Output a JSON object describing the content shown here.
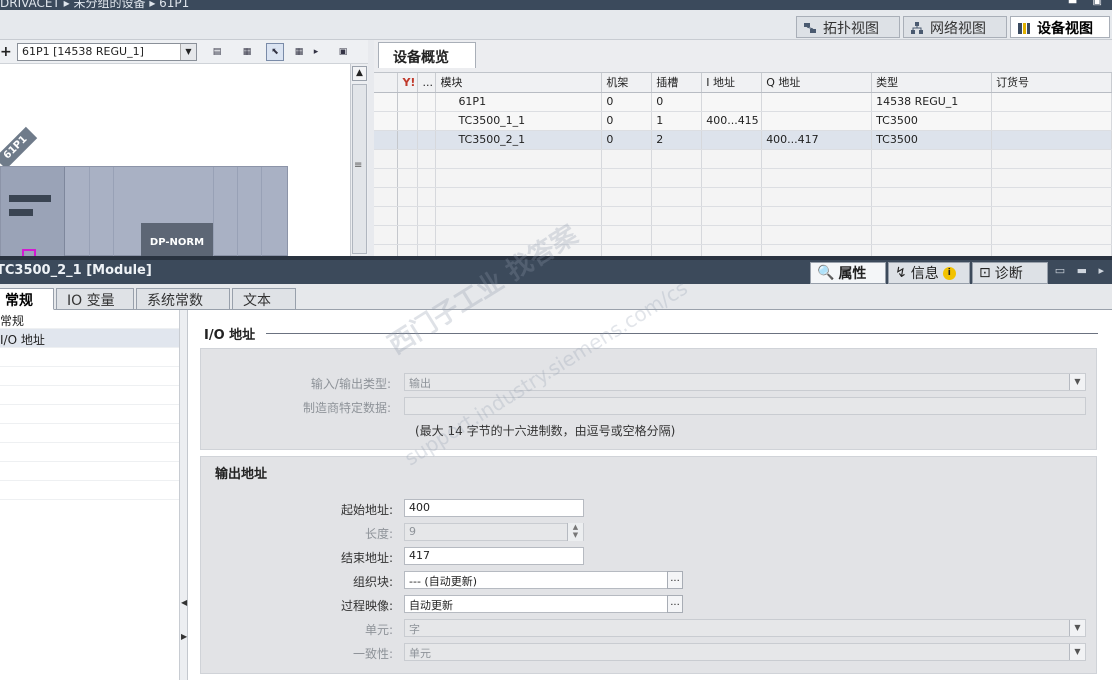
{
  "breadcrumb": {
    "text": "DRIVACET  ▸  未分组的设备  ▸  61P1"
  },
  "window_controls": "▬ ▣",
  "view_tabs": [
    {
      "label": "拓扑视图",
      "icon": "topology-icon"
    },
    {
      "label": "网络视图",
      "icon": "network-icon"
    },
    {
      "label": "设备视图",
      "icon": "device-icon"
    }
  ],
  "canvas": {
    "device_select": "61P1 [14538 REGU_1]",
    "device_label": "61P1",
    "module_label": "DP-NORM"
  },
  "overview": {
    "tab_label": "设备概览",
    "columns": [
      "",
      "...",
      "模块",
      "机架",
      "插槽",
      "I 地址",
      "Q 地址",
      "类型",
      "订货号"
    ],
    "rows": [
      {
        "module": "61P1",
        "rack": "0",
        "slot": "0",
        "i_addr": "",
        "q_addr": "",
        "type": "14538 REGU_1",
        "order": ""
      },
      {
        "module": "TC3500_1_1",
        "rack": "0",
        "slot": "1",
        "i_addr": "400...415",
        "q_addr": "",
        "type": "TC3500",
        "order": ""
      },
      {
        "module": "TC3500_2_1",
        "rack": "0",
        "slot": "2",
        "i_addr": "",
        "q_addr": "400...417",
        "type": "TC3500",
        "order": ""
      }
    ]
  },
  "inspector": {
    "title": "TC3500_2_1 [Module]",
    "tabs": [
      "属性",
      "信息",
      "诊断"
    ],
    "subtabs": [
      "常规",
      "IO 变量",
      "系统常数",
      "文本"
    ],
    "nav": [
      "常规",
      "I/O 地址"
    ]
  },
  "io": {
    "section_title": "I/O 地址",
    "io_type_label": "输入/输出类型:",
    "io_type_value": "输出",
    "mfr_label": "制造商特定数据:",
    "mfr_value": "",
    "hint": "(最大 14 字节的十六进制数，由逗号或空格分隔)",
    "output_title": "输出地址",
    "start_label": "起始地址:",
    "start_value": "400",
    "length_label": "长度:",
    "length_value": "9",
    "end_label": "结束地址:",
    "end_value": "417",
    "ob_label": "组织块:",
    "ob_value": "--- (自动更新)",
    "pi_label": "过程映像:",
    "pi_value": "自动更新",
    "unit_label": "单元:",
    "unit_value": "字",
    "consistency_label": "一致性:",
    "consistency_value": "单元"
  },
  "watermark": {
    "line1": "西门子工业 找答案",
    "line2": "support.industry.siemens.com/cs"
  }
}
